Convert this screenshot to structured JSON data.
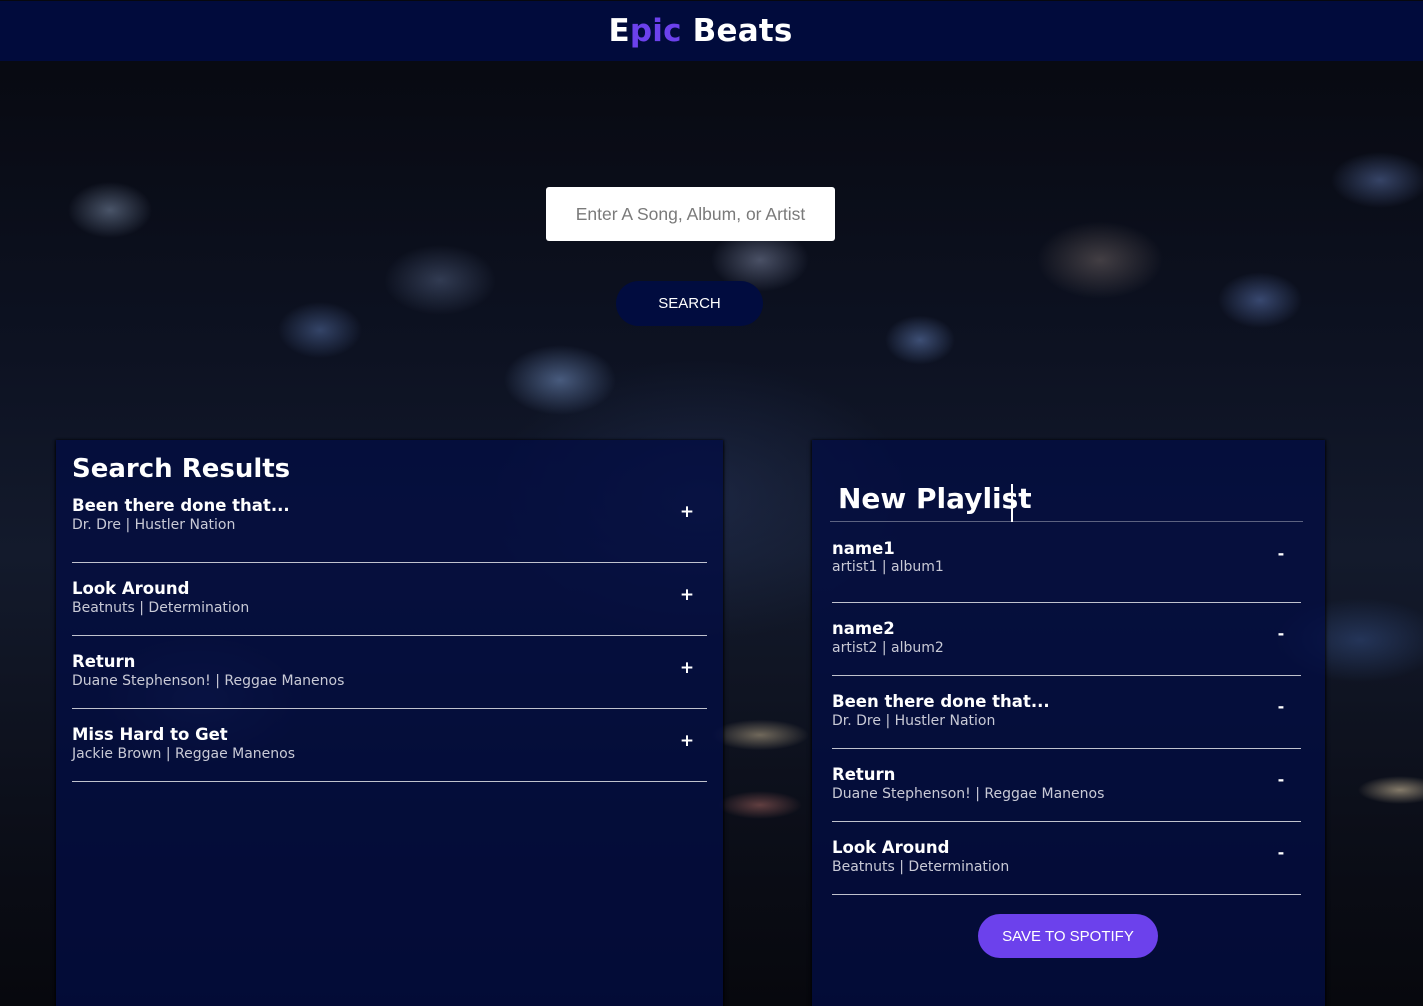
{
  "header": {
    "logo_first": "E",
    "logo_accent": "pic",
    "logo_rest": " Beats"
  },
  "search": {
    "placeholder": "Enter A Song, Album, or Artist",
    "value": "",
    "button_label": "SEARCH"
  },
  "results": {
    "title": "Search Results",
    "action_symbol": "+",
    "tracks": [
      {
        "name": "Been there done that...",
        "info": "Dr. Dre | Hustler Nation"
      },
      {
        "name": "Look Around",
        "info": "Beatnuts | Determination"
      },
      {
        "name": "Return",
        "info": "Duane Stephenson! | Reggae Manenos"
      },
      {
        "name": "Miss Hard to Get",
        "info": "Jackie Brown | Reggae Manenos"
      }
    ]
  },
  "playlist": {
    "name": "New Playlist",
    "action_symbol": "-",
    "save_label": "SAVE TO SPOTIFY",
    "tracks": [
      {
        "name": "name1",
        "info": "artist1 | album1"
      },
      {
        "name": "name2",
        "info": "artist2 | album2"
      },
      {
        "name": "Been there done that...",
        "info": "Dr. Dre | Hustler Nation"
      },
      {
        "name": "Return",
        "info": "Duane Stephenson! | Reggae Manenos"
      },
      {
        "name": "Look Around",
        "info": "Beatnuts | Determination"
      }
    ]
  },
  "colors": {
    "header_bg": "#010b3c",
    "accent": "#6c41ec",
    "panel_bg": "#030d42"
  }
}
